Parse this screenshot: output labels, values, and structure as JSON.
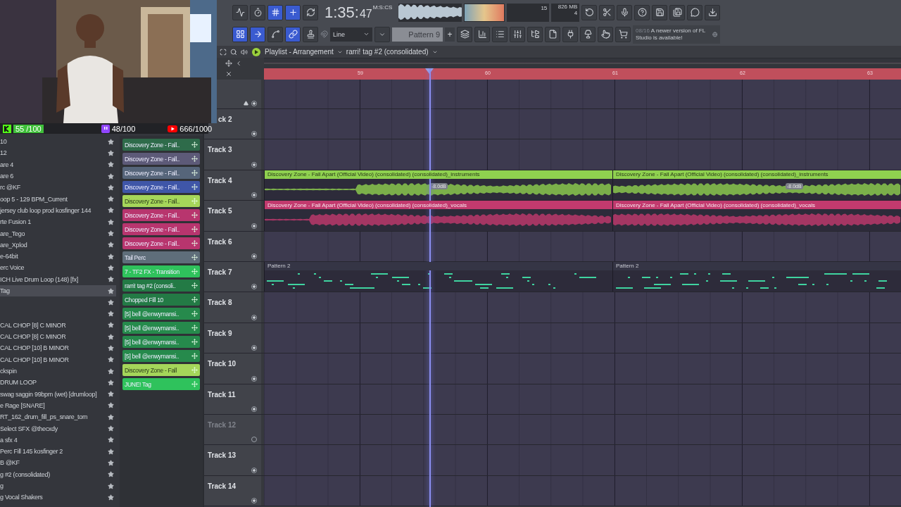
{
  "stream_stats": [
    {
      "kind": "kick",
      "text": "55 /100"
    },
    {
      "kind": "twitch",
      "text": "48/100"
    },
    {
      "kind": "youtube",
      "text": "666/1000"
    }
  ],
  "toolbar": {
    "left_buttons": [
      {
        "on": false
      },
      {
        "on": false
      },
      {
        "on": true
      },
      {
        "on": true
      },
      {
        "on": false
      }
    ],
    "time": "1:35:",
    "time_small": "47",
    "time_unit": "M:S:CS",
    "cpu_value": "15",
    "memory": "826 MB",
    "polyphony": "4",
    "right_buttons": [
      {
        "on": false
      },
      {
        "on": false
      },
      {
        "on": false
      },
      {
        "on": false
      },
      {
        "on": false
      },
      {
        "on": false
      },
      {
        "on": false
      },
      {
        "on": false
      }
    ],
    "mode_buttons": [
      {
        "on": true
      },
      {
        "on": true
      },
      {
        "on": false
      },
      {
        "on": true
      },
      {
        "on": false
      }
    ],
    "snap": "Line",
    "pattern": "Pattern 9",
    "pattern_add": "+",
    "tool_buttons": [
      {
        "on": false
      },
      {
        "on": false
      },
      {
        "on": false
      },
      {
        "on": false
      },
      {
        "on": false
      },
      {
        "on": false
      },
      {
        "on": false
      },
      {
        "on": false
      },
      {
        "on": false
      },
      {
        "on": false
      }
    ],
    "news": {
      "date": "08/16",
      "text": "A newer version of FL Studio is available!"
    }
  },
  "browser": {
    "items": [
      {
        "kind": "file",
        "label": "10",
        "selected": false
      },
      {
        "kind": "file",
        "label": "12",
        "selected": false
      },
      {
        "kind": "file",
        "label": "are 4",
        "selected": false
      },
      {
        "kind": "file",
        "label": "are 6",
        "selected": false
      },
      {
        "kind": "file",
        "label": "rc @KF",
        "selected": false
      },
      {
        "kind": "file",
        "label": "oop 5 - 129 BPM_Current",
        "selected": false
      },
      {
        "kind": "file",
        "label": "jersey club loop prod kosfinger 144",
        "selected": false
      },
      {
        "kind": "file",
        "label": "rte Fusion 1",
        "selected": false
      },
      {
        "kind": "file",
        "label": "are_Tego",
        "selected": false
      },
      {
        "kind": "file",
        "label": "are_Xplod",
        "selected": false
      },
      {
        "kind": "file",
        "label": "e-64bit",
        "selected": false
      },
      {
        "kind": "file",
        "label": "erc Voice",
        "selected": false
      },
      {
        "kind": "file",
        "label": "ICH Live Drum Loop (148) [fx]",
        "selected": false
      },
      {
        "kind": "file",
        "label": "Tag",
        "selected": true
      },
      {
        "kind": "blank",
        "selected": false
      },
      {
        "kind": "blank",
        "selected": false
      },
      {
        "kind": "file",
        "label": "CAL CHOP [8] C MINOR",
        "selected": false
      },
      {
        "kind": "file",
        "label": "CAL CHOP [8] C MINOR",
        "selected": false
      },
      {
        "kind": "file",
        "label": "CAL CHOP [10] B MINOR",
        "selected": false
      },
      {
        "kind": "file",
        "label": "CAL CHOP [10] B MINOR",
        "selected": false
      },
      {
        "kind": "file",
        "label": "ckspin",
        "selected": false
      },
      {
        "kind": "file",
        "label": "DRUM LOOP",
        "selected": false
      },
      {
        "kind": "file",
        "label": "swag saggin 99bpm (wet) [drumloop]",
        "selected": false
      },
      {
        "kind": "file",
        "label": "e Rage [SNARE]",
        "selected": false
      },
      {
        "kind": "file",
        "label": "RT_162_drum_fill_ps_snare_tom",
        "selected": false
      },
      {
        "kind": "file",
        "label": "Select SFX @thecxdy",
        "selected": false
      },
      {
        "kind": "file",
        "label": "a sfx 4",
        "selected": false
      },
      {
        "kind": "file",
        "label": "Perc Fill 145 kosfinger 2",
        "selected": false
      },
      {
        "kind": "file",
        "label": "B @KF",
        "selected": false
      },
      {
        "kind": "file",
        "label": "g #2 (consolidated)",
        "selected": false
      },
      {
        "kind": "file",
        "label": "g",
        "selected": false
      },
      {
        "kind": "file",
        "label": "g Vocal Shakers",
        "selected": false
      }
    ]
  },
  "clip_list": [
    {
      "label": "Discovery Zone - Fall..",
      "color": "#2e6b4a"
    },
    {
      "label": "Discovery Zone - Fall..",
      "color": "#5d5a78"
    },
    {
      "label": "Discovery Zone - Fall..",
      "color": "#56657a"
    },
    {
      "label": "Discovery Zone - Fall..",
      "color": "#3f56a8"
    },
    {
      "label": "Discovery Zone - Fall..",
      "color": "#a5d65a"
    },
    {
      "label": "Discovery Zone - Fall..",
      "color": "#b8356e"
    },
    {
      "label": "Discovery Zone - Fall..",
      "color": "#b8356e"
    },
    {
      "label": "Discovery Zone - Fall..",
      "color": "#b8356e"
    },
    {
      "label": "Tail Perc",
      "color": "#5f6e7a"
    },
    {
      "label": "7 - TF2 FX - Transition",
      "color": "#2fc25c"
    },
    {
      "label": "rarri! tag #2 (consoli..",
      "color": "#237a45"
    },
    {
      "label": "Chopped Fill 10",
      "color": "#237a45"
    },
    {
      "label": "[5] bell @enwymansi..",
      "color": "#268a4c"
    },
    {
      "label": "[5] bell @enwymansi..",
      "color": "#268a4c"
    },
    {
      "label": "[5] bell @enwymansi..",
      "color": "#268a4c"
    },
    {
      "label": "[5] bell @enwymansi..",
      "color": "#268a4c"
    },
    {
      "label": "Discovery Zone - Fall",
      "color": "#a5d65a"
    },
    {
      "label": "JUNE! Tag",
      "color": "#2fc25c"
    }
  ],
  "playlist": {
    "title": "Playlist - Arrangement",
    "arrangement": "rarri! tag #2 (consolidated)",
    "ruler": [
      "59",
      "60",
      "61",
      "62",
      "63"
    ],
    "tracks": [
      {
        "label": "ck 2",
        "disabled": false
      },
      {
        "label": "Track 3",
        "disabled": false
      },
      {
        "label": "Track 4",
        "disabled": false,
        "clips": [
          {
            "kind": "audio",
            "label": "Discovery Zone - Fall Apart (Official Video) (consolidated) (consolidated)_instruments",
            "color": "#8fd14f",
            "gain": "-8.0dB"
          },
          {
            "kind": "audio",
            "label": "Discovery Zone - Fall Apart (Official Video) (consolidated) (consolidated)_instruments",
            "color": "#8fd14f",
            "gain": "-8.0dB"
          }
        ]
      },
      {
        "label": "Track 5",
        "disabled": false,
        "clips": [
          {
            "kind": "audio",
            "label": "Discovery Zone - Fall Apart (Official Video) (consolidated) (consolidated)_vocals",
            "color": "#c23a6e"
          },
          {
            "kind": "audio",
            "label": "Discovery Zone - Fall Apart (Official Video) (consolidated) (consolidated)_vocals",
            "color": "#c23a6e"
          }
        ]
      },
      {
        "label": "Track 6",
        "disabled": false
      },
      {
        "label": "Track 7",
        "disabled": false,
        "clips": [
          {
            "kind": "pattern",
            "label": "Pattern 2"
          },
          {
            "kind": "pattern",
            "label": "Pattern 2"
          }
        ]
      },
      {
        "label": "Track 8",
        "disabled": false
      },
      {
        "label": "Track 9",
        "disabled": false
      },
      {
        "label": "Track 10",
        "disabled": false
      },
      {
        "label": "Track 11",
        "disabled": false
      },
      {
        "label": "Track 12",
        "disabled": true
      },
      {
        "label": "Track 13",
        "disabled": false
      },
      {
        "label": "Track 14",
        "disabled": false
      }
    ]
  }
}
